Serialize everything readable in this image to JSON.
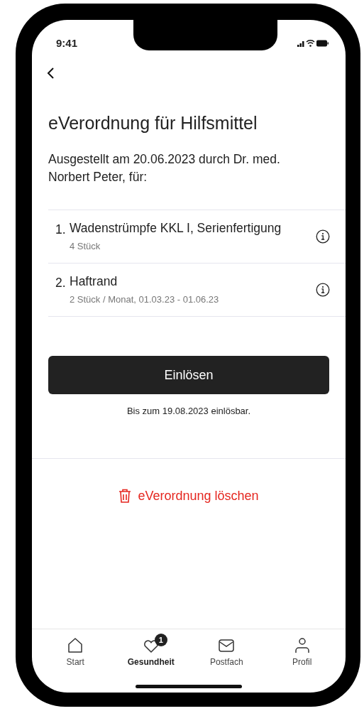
{
  "status_bar": {
    "time": "9:41"
  },
  "title": "eVerordnung für Hilfsmittel",
  "intro": "Ausgestellt am 20.06.2023 durch Dr. med. Norbert Peter, für:",
  "items": [
    {
      "number": "1.",
      "name": "Wadenstrümpfe KKL I, Serienfertigung",
      "detail": "4 Stück"
    },
    {
      "number": "2.",
      "name": "Haftrand",
      "detail": "2 Stück / Monat, 01.03.23 - 01.06.23"
    }
  ],
  "redeem_button": "Einlösen",
  "redeem_note": "Bis zum 19.08.2023 einlösbar.",
  "delete_button": "eVerordnung löschen",
  "tabs": [
    {
      "kind": "home",
      "label": "Start",
      "selected": false
    },
    {
      "kind": "heart",
      "label": "Gesundheit",
      "selected": true,
      "badge": "1"
    },
    {
      "kind": "mail",
      "label": "Postfach",
      "selected": false
    },
    {
      "kind": "person",
      "label": "Profil",
      "selected": false
    }
  ]
}
